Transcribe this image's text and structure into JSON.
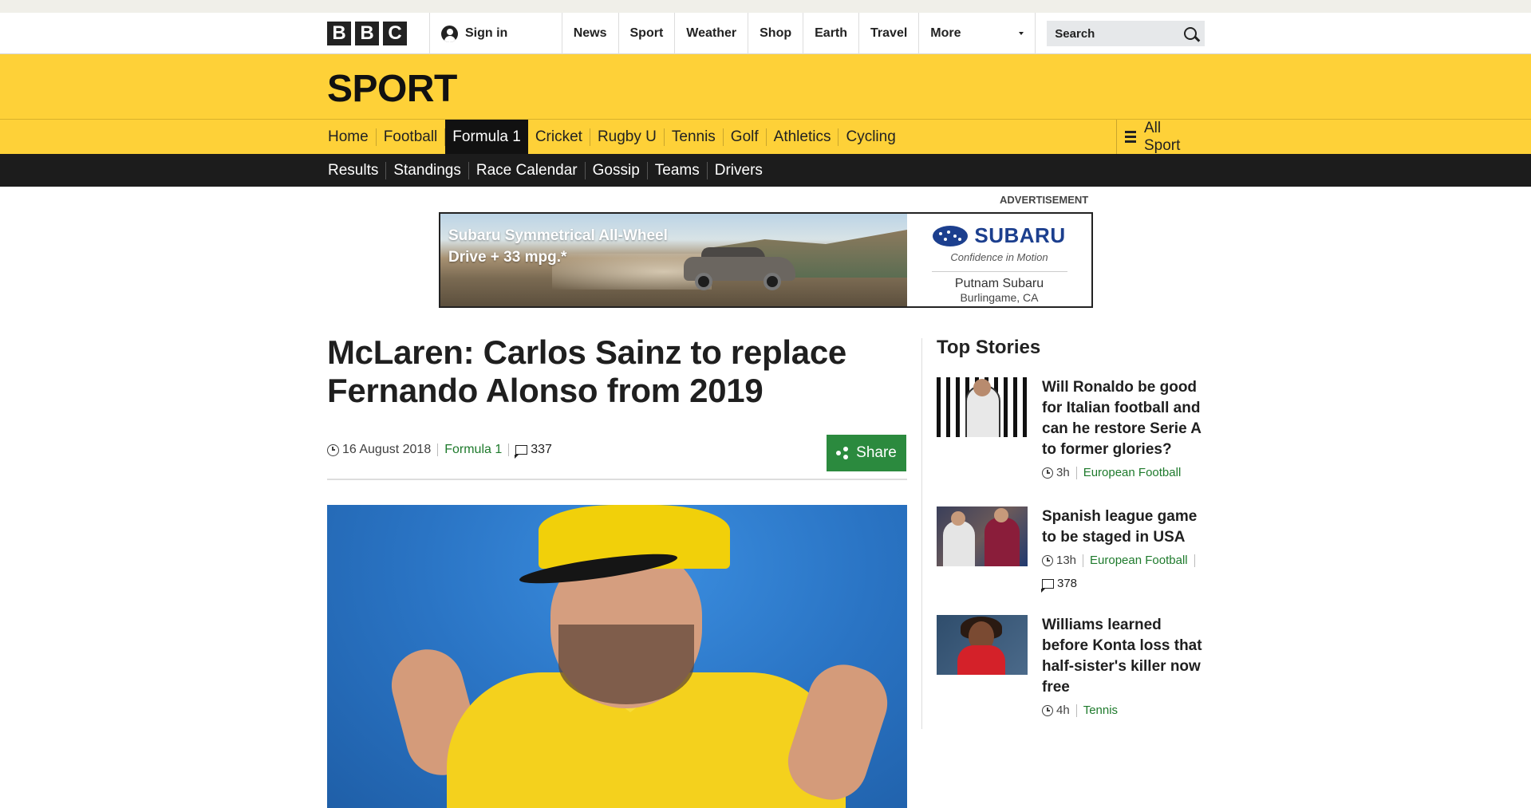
{
  "topbar": {
    "logo_letters": [
      "B",
      "B",
      "C"
    ],
    "sign_in": "Sign in",
    "nav": [
      "News",
      "Sport",
      "Weather",
      "Shop",
      "Earth",
      "Travel"
    ],
    "more": "More",
    "search_placeholder": "Search"
  },
  "sport": {
    "title": "SPORT",
    "nav": [
      "Home",
      "Football",
      "Formula 1",
      "Cricket",
      "Rugby U",
      "Tennis",
      "Golf",
      "Athletics",
      "Cycling"
    ],
    "active_nav": "Formula 1",
    "all_sport": "All Sport",
    "subnav": [
      "Results",
      "Standings",
      "Race Calendar",
      "Gossip",
      "Teams",
      "Drivers"
    ]
  },
  "ad": {
    "label": "ADVERTISEMENT",
    "headline_line1": "Subaru Symmetrical All-Wheel",
    "headline_line2": "Drive + 33 mpg.*",
    "brand": "SUBARU",
    "tagline": "Confidence in Motion",
    "dealer": "Putnam Subaru",
    "location": "Burlingame, CA"
  },
  "article": {
    "headline": "McLaren: Carlos Sainz to replace Fernando Alonso from 2019",
    "date": "16 August 2018",
    "section": "Formula 1",
    "comments": "337",
    "share": "Share"
  },
  "sidebar": {
    "title": "Top Stories",
    "stories": [
      {
        "title": "Will Ronaldo be good for Italian football and can he restore Serie A to former glories?",
        "time": "3h",
        "section": "European Football"
      },
      {
        "title": "Spanish league game to be staged in USA",
        "time": "13h",
        "section": "European Football",
        "comments": "378"
      },
      {
        "title": "Williams learned before Konta loss that half-sister's killer now free",
        "time": "4h",
        "section": "Tennis"
      }
    ]
  },
  "colors": {
    "sport_yellow": "#fed138",
    "subnav_black": "#1c1c1c",
    "share_green": "#2b8a3e",
    "link_green": "#1e7a2c"
  }
}
